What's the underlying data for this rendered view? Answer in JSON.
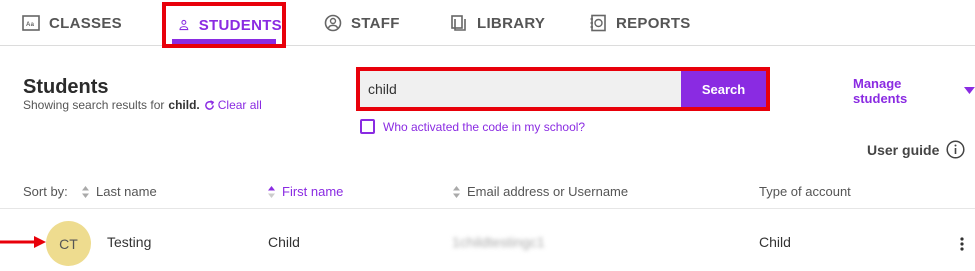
{
  "tabs": [
    {
      "label": "CLASSES",
      "icon": "classes-icon"
    },
    {
      "label": "STUDENTS",
      "icon": "student-icon",
      "active": true
    },
    {
      "label": "STAFF",
      "icon": "staff-icon"
    },
    {
      "label": "LIBRARY",
      "icon": "library-icon"
    },
    {
      "label": "REPORTS",
      "icon": "reports-icon"
    }
  ],
  "header": {
    "title": "Students",
    "results_prefix": "Showing search results for",
    "results_query": "child.",
    "clear_label": "Clear all"
  },
  "search": {
    "value": "child",
    "button_label": "Search"
  },
  "activated_label": "Who activated the code in my school?",
  "manage_label": "Manage students",
  "guide_label": "User guide",
  "table": {
    "sort_by_label": "Sort by:",
    "columns": [
      "Last name",
      "First name",
      "Email address or Username",
      "Type of account"
    ],
    "rows": [
      {
        "initials": "CT",
        "last_name": "Testing",
        "first_name": "Child",
        "username": "1childtestingc1",
        "type": "Child"
      }
    ]
  },
  "colors": {
    "accent": "#8a2be2",
    "highlight": "#e8000a",
    "avatar": "#eedc8f"
  }
}
